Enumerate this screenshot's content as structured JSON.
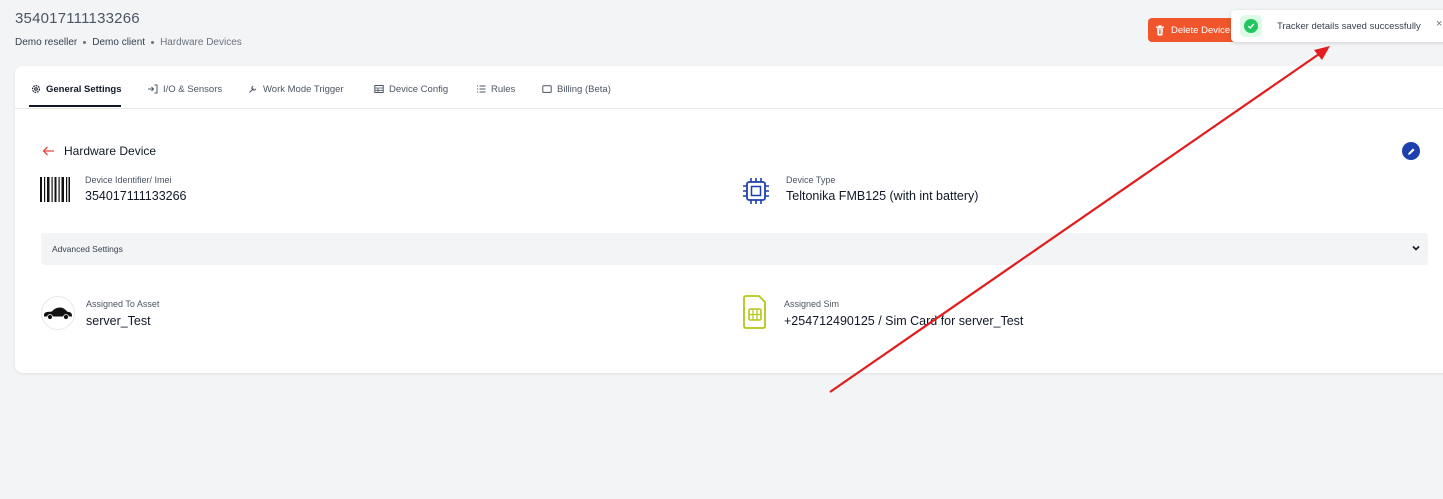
{
  "page": {
    "title": "354017111133266",
    "breadcrumb": [
      "Demo reseller",
      "Demo client",
      "Hardware Devices"
    ]
  },
  "header": {
    "delete_label": "Delete Device"
  },
  "toast": {
    "message": "Tracker details saved successfully",
    "close": "×"
  },
  "tabs": [
    {
      "label": "General Settings",
      "icon": "gear-icon",
      "active": true
    },
    {
      "label": "I/O & Sensors",
      "icon": "sign-in-icon"
    },
    {
      "label": "Work Mode Trigger",
      "icon": "wrench-icon"
    },
    {
      "label": "Device Config",
      "icon": "table-icon"
    },
    {
      "label": "Rules",
      "icon": "list-icon"
    },
    {
      "label": "Billing (Beta)",
      "icon": "card-icon"
    }
  ],
  "section": {
    "title": "Hardware Device"
  },
  "fields": {
    "imei_label": "Device Identifier/ Imei",
    "imei_value": "354017111133266",
    "type_label": "Device Type",
    "type_value": "Teltonika FMB125 (with int battery)",
    "asset_label": "Assigned To Asset",
    "asset_value": "server_Test",
    "sim_label": "Assigned Sim",
    "sim_value": "+254712490125 / Sim Card for server_Test"
  },
  "advanced": {
    "label": "Advanced Settings"
  },
  "colors": {
    "danger": "#f0552b",
    "success": "#22c55e",
    "primary": "#1e40af",
    "annotation": "#e11d1d"
  }
}
